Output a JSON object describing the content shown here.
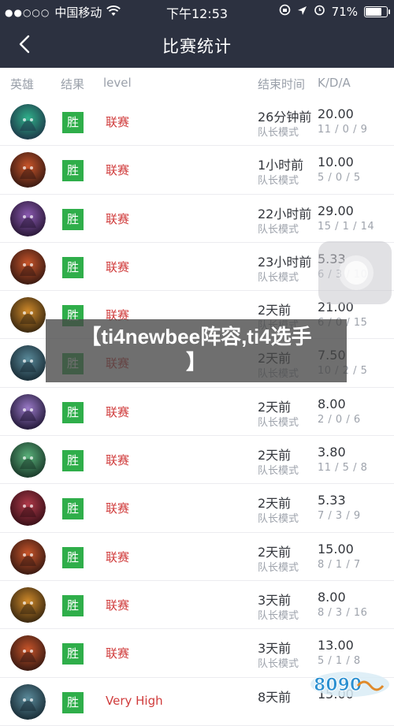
{
  "status_bar": {
    "signal_dots": "●●○○○",
    "carrier": "中国移动",
    "wifi_icon": "wifi-icon",
    "time": "下午12:53",
    "battery_text": "71%",
    "battery_level": 0.71
  },
  "nav": {
    "title": "比赛统计",
    "back_icon": "chevron-left-icon"
  },
  "columns": {
    "hero": "英雄",
    "result": "结果",
    "level": "level",
    "end_time": "结束时间",
    "kda": "K/D/A"
  },
  "matches": [
    {
      "result": "胜",
      "level": "联赛",
      "end_time": "26分钟前",
      "mode": "队长模式",
      "kda": "20.00",
      "kda_detail": "11 / 0 / 9",
      "hero": "green-hero"
    },
    {
      "result": "胜",
      "level": "联赛",
      "end_time": "1小时前",
      "mode": "队长模式",
      "kda": "10.00",
      "kda_detail": "5 / 0 / 5",
      "hero": "red-helm-hero"
    },
    {
      "result": "胜",
      "level": "联赛",
      "end_time": "22小时前",
      "mode": "队长模式",
      "kda": "29.00",
      "kda_detail": "15 / 1 / 14",
      "hero": "purple-hero"
    },
    {
      "result": "胜",
      "level": "联赛",
      "end_time": "23小时前",
      "mode": "队长模式",
      "kda": "5.33",
      "kda_detail": "6 / 3 / 10",
      "hero": "red-helm-hero"
    },
    {
      "result": "胜",
      "level": "联赛",
      "end_time": "2天前",
      "mode": "队长模式",
      "kda": "21.00",
      "kda_detail": "6 / 0 / 15",
      "hero": "orange-hero"
    },
    {
      "result": "胜",
      "level": "联赛",
      "end_time": "2天前",
      "mode": "队长模式",
      "kda": "7.50",
      "kda_detail": "10 / 2 / 5",
      "hero": "teal-hero"
    },
    {
      "result": "胜",
      "level": "联赛",
      "end_time": "2天前",
      "mode": "队长模式",
      "kda": "8.00",
      "kda_detail": "2 / 0 / 6",
      "hero": "violet-hero"
    },
    {
      "result": "胜",
      "level": "联赛",
      "end_time": "2天前",
      "mode": "队长模式",
      "kda": "3.80",
      "kda_detail": "11 / 5 / 8",
      "hero": "green-face-hero"
    },
    {
      "result": "胜",
      "level": "联赛",
      "end_time": "2天前",
      "mode": "队长模式",
      "kda": "5.33",
      "kda_detail": "7 / 3 / 9",
      "hero": "crimson-hero"
    },
    {
      "result": "胜",
      "level": "联赛",
      "end_time": "2天前",
      "mode": "队长模式",
      "kda": "15.00",
      "kda_detail": "8 / 1 / 7",
      "hero": "red-helm-hero"
    },
    {
      "result": "胜",
      "level": "联赛",
      "end_time": "3天前",
      "mode": "队长模式",
      "kda": "8.00",
      "kda_detail": "8 / 3 / 16",
      "hero": "orange-hero"
    },
    {
      "result": "胜",
      "level": "联赛",
      "end_time": "3天前",
      "mode": "队长模式",
      "kda": "13.00",
      "kda_detail": "5 / 1 / 8",
      "hero": "red-helm-hero"
    },
    {
      "result": "胜",
      "level": "Very High",
      "end_time": "8天前",
      "mode": "",
      "kda": "15.00",
      "kda_detail": "",
      "hero": "teal-hero"
    }
  ],
  "overlay": {
    "title_line1": "【ti4newbee阵容,ti4选手",
    "title_line2": "】"
  },
  "colors": {
    "nav_bg": "#2c3140",
    "win_green": "#2fae4a",
    "level_red": "#d03c3c"
  },
  "hero_colors": {
    "green-hero": [
      "#1e3b4a",
      "#2fb08a"
    ],
    "red-helm-hero": [
      "#3a1a12",
      "#c8552a"
    ],
    "purple-hero": [
      "#2a1838",
      "#8a5ab0"
    ],
    "orange-hero": [
      "#3a2810",
      "#d08a2a"
    ],
    "teal-hero": [
      "#1a2e38",
      "#5a8a9a"
    ],
    "violet-hero": [
      "#241a3a",
      "#9a7ac8"
    ],
    "green-face-hero": [
      "#1a3a2a",
      "#5ab07a"
    ],
    "crimson-hero": [
      "#3a1018",
      "#b03a4a"
    ]
  }
}
